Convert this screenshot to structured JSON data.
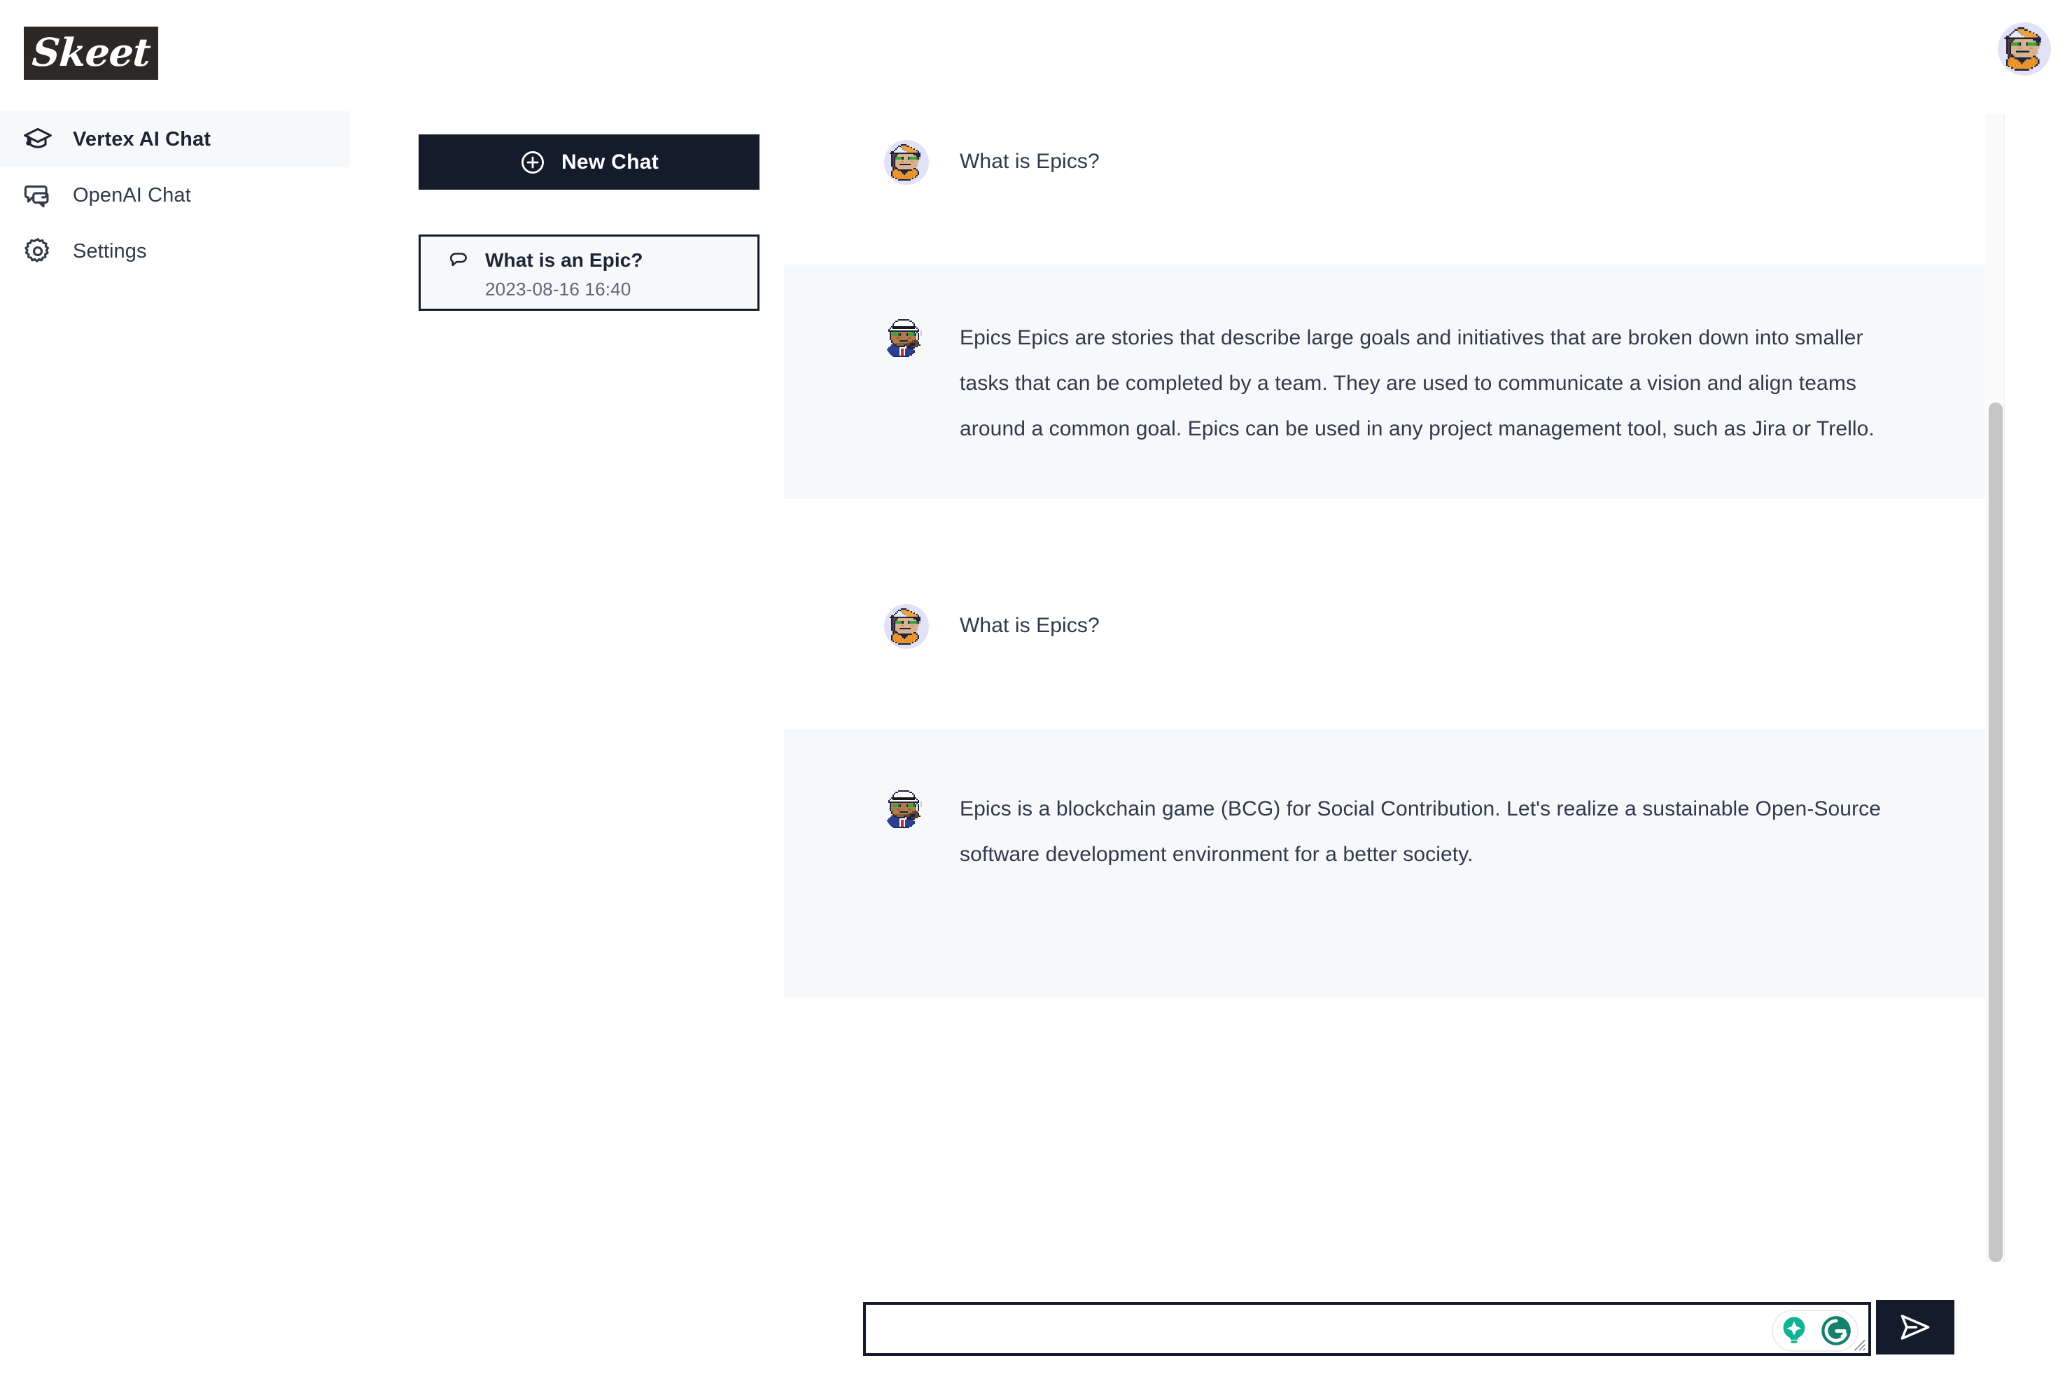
{
  "app": {
    "logo_text": "Skeet",
    "accent_dark": "#141b2b",
    "panel_bg": "#f7f8fa",
    "text_color": "#303a4b"
  },
  "sidebar": {
    "items": [
      {
        "label": "Vertex AI Chat",
        "icon": "graduation-cap-icon",
        "active": true
      },
      {
        "label": "OpenAI Chat",
        "icon": "chat-bubbles-icon",
        "active": false
      },
      {
        "label": "Settings",
        "icon": "gear-icon",
        "active": false
      }
    ]
  },
  "chatlist": {
    "new_chat_label": "New Chat",
    "new_chat_icon": "plus-circle-icon",
    "items": [
      {
        "icon": "chat-bubble-icon",
        "title": "What is an Epic?",
        "date": "2023-08-16 16:40",
        "selected": true
      }
    ]
  },
  "header": {
    "avatar": "user-avatar"
  },
  "conversation": {
    "messages": [
      {
        "role": "user",
        "avatar": "user-avatar",
        "text": "What is Epics?"
      },
      {
        "role": "assistant",
        "avatar": "assistant-avatar",
        "text": "Epics Epics are stories that describe large goals and initiatives that are broken down into smaller tasks that can be completed by a team. They are used to communicate a vision and align teams around a common goal. Epics can be used in any project management tool, such as Jira or Trello."
      },
      {
        "role": "user",
        "avatar": "user-avatar",
        "text": "What is Epics?"
      },
      {
        "role": "assistant",
        "avatar": "assistant-avatar",
        "text": "Epics is a blockchain game (BCG) for Social Contribution. Let's realize a sustainable Open-Source software development environment for a better society."
      }
    ]
  },
  "composer": {
    "value": "",
    "placeholder": "",
    "grammarly": {
      "lightbulb_icon": "grammarly-suggestion-icon",
      "logo_icon": "grammarly-logo-icon"
    },
    "send_icon": "send-paper-plane-icon"
  }
}
